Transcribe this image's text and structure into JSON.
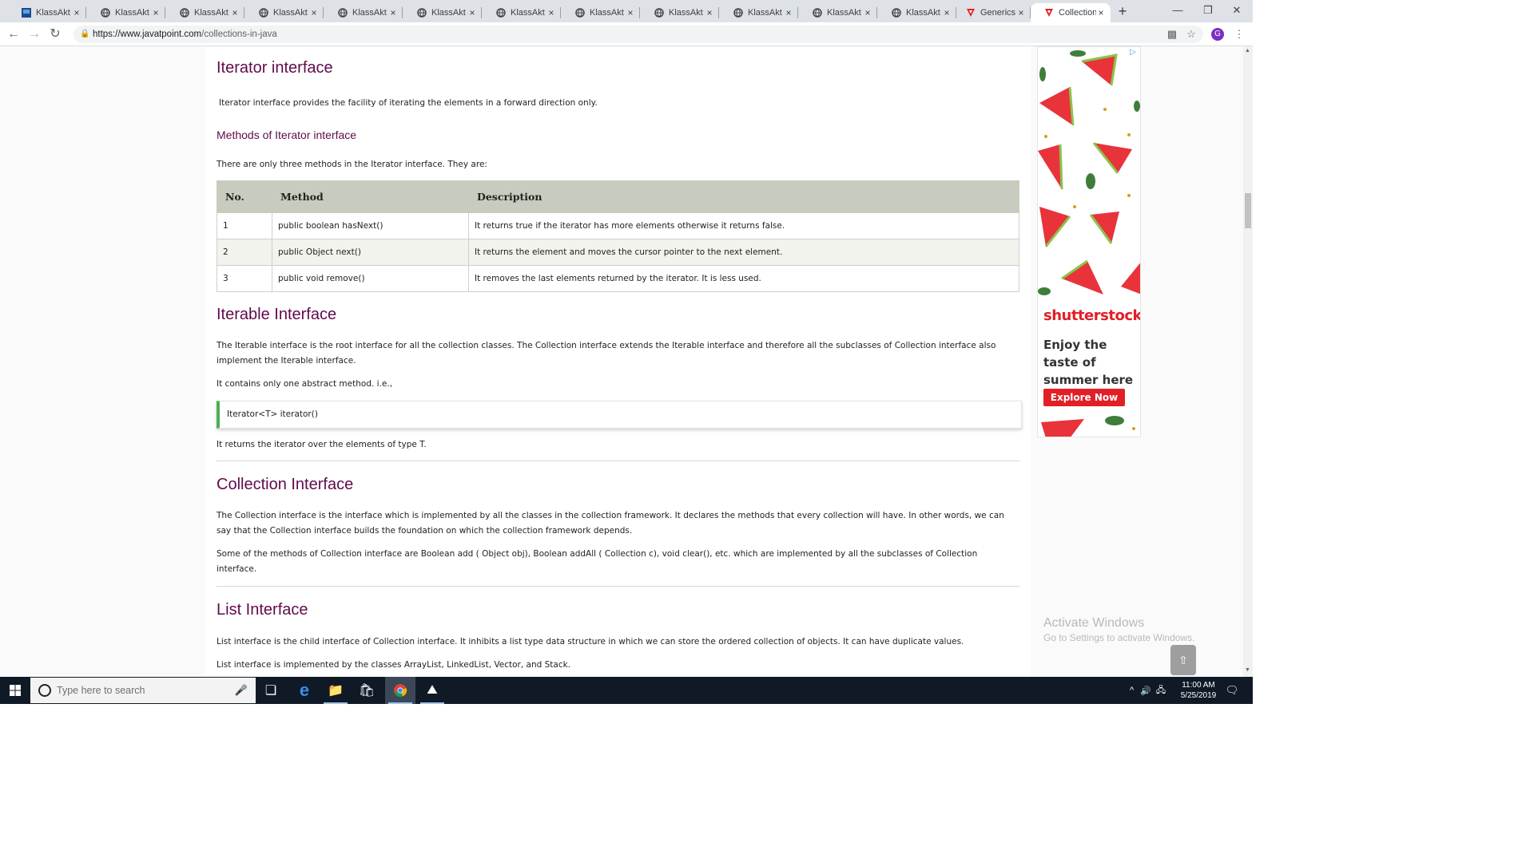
{
  "browser": {
    "tabs": [
      {
        "title": "KlassAkt LI",
        "icon": "klassakt-favicon"
      },
      {
        "title": "KlassAkt LI",
        "icon": "globe-favicon"
      },
      {
        "title": "KlassAkt LI",
        "icon": "globe-favicon"
      },
      {
        "title": "KlassAkt LI",
        "icon": "globe-favicon"
      },
      {
        "title": "KlassAkt LI",
        "icon": "globe-favicon"
      },
      {
        "title": "KlassAkt LI",
        "icon": "globe-favicon"
      },
      {
        "title": "KlassAkt LI",
        "icon": "globe-favicon"
      },
      {
        "title": "KlassAkt LI",
        "icon": "globe-favicon"
      },
      {
        "title": "KlassAkt LI",
        "icon": "globe-favicon"
      },
      {
        "title": "KlassAkt LI",
        "icon": "globe-favicon"
      },
      {
        "title": "KlassAkt LI",
        "icon": "globe-favicon"
      },
      {
        "title": "KlassAkt LI",
        "icon": "globe-favicon"
      },
      {
        "title": "Generics in",
        "icon": "javatpoint-favicon"
      },
      {
        "title": "Collection",
        "icon": "javatpoint-favicon",
        "active": true
      }
    ],
    "close_glyph": "×",
    "new_tab_glyph": "+",
    "url_host": "https://www.javatpoint.com",
    "url_path": "/collections-in-java",
    "profile_initial": "G"
  },
  "article": {
    "iterator": {
      "heading": "Iterator interface",
      "intro": "Iterator interface provides the facility of iterating the elements in a forward direction only.",
      "methods_heading": "Methods of Iterator interface",
      "methods_intro": "There are only three methods in the Iterator interface. They are:",
      "table": {
        "headers": [
          "No.",
          "Method",
          "Description"
        ],
        "rows": [
          [
            "1",
            "public boolean hasNext()",
            "It returns true if the iterator has more elements otherwise it returns false."
          ],
          [
            "2",
            "public Object next()",
            "It returns the element and moves the cursor pointer to the next element."
          ],
          [
            "3",
            "public void remove()",
            "It removes the last elements returned by the iterator. It is less used."
          ]
        ]
      }
    },
    "iterable": {
      "heading": "Iterable Interface",
      "p1": "The Iterable interface is the root interface for all the collection classes. The Collection interface extends the Iterable interface and therefore all the subclasses of Collection interface also implement the Iterable interface.",
      "p2": "It contains only one abstract method. i.e.,",
      "code": "Iterator<T> iterator()",
      "p3": "It returns the iterator over the elements of type T."
    },
    "collection": {
      "heading": "Collection Interface",
      "p1": "The Collection interface is the interface which is implemented by all the classes in the collection framework. It declares the methods that every collection will have. In other words, we can say that the Collection interface builds the foundation on which the collection framework depends.",
      "p2": "Some of the methods of Collection interface are Boolean add ( Object obj), Boolean addAll ( Collection c), void clear(), etc. which are implemented by all the subclasses of Collection interface."
    },
    "list": {
      "heading": "List Interface",
      "p1": "List interface is the child interface of Collection interface. It inhibits a list type data structure in which we can store the ordered collection of objects. It can have duplicate values.",
      "p2": "List interface is implemented by the classes ArrayList, LinkedList, Vector, and Stack."
    }
  },
  "ad": {
    "brand": "shutterstock",
    "tagline": "Enjoy the taste of summer here",
    "cta": "Explore Now",
    "accent": "#e21e26"
  },
  "activation": {
    "title": "Activate Windows",
    "subtitle": "Go to Settings to activate Windows."
  },
  "taskbar": {
    "search_placeholder": "Type here to search",
    "time": "11:00 AM",
    "date": "5/25/2019"
  },
  "colors": {
    "heading": "#610b4b",
    "table_header": "#c7ccbe",
    "code_accent": "#4caf50"
  }
}
